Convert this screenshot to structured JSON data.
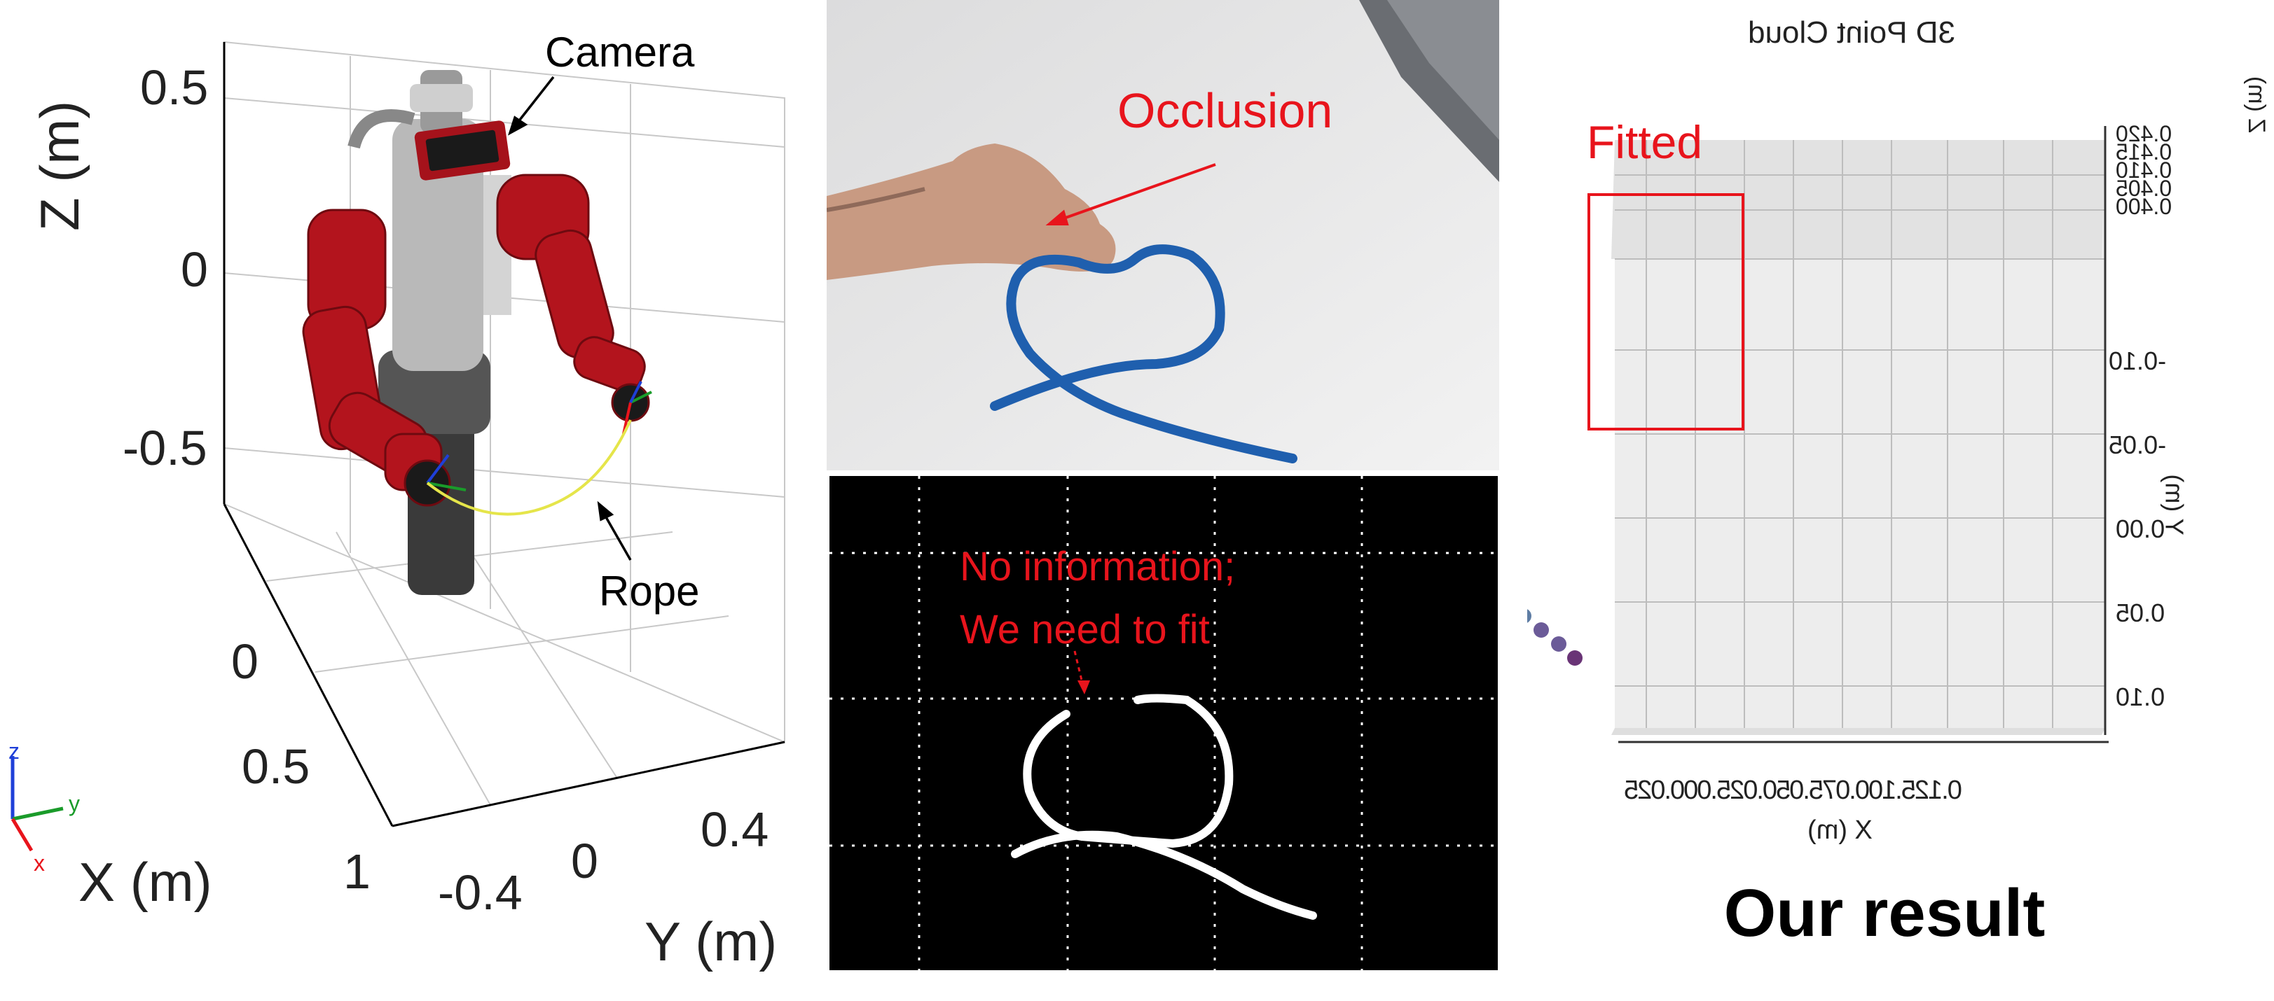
{
  "robot_panel": {
    "z_axis_label": "Z (m)",
    "x_axis_label": "X (m)",
    "y_axis_label": "Y (m)",
    "z_ticks": [
      "0.5",
      "0",
      "-0.5"
    ],
    "x_ticks": [
      "0",
      "0.5",
      "1"
    ],
    "y_ticks": [
      "-0.4",
      "0",
      "0.4"
    ],
    "camera_label": "Camera",
    "rope_label": "Rope",
    "triad": {
      "z": "z",
      "y": "y",
      "x": "x"
    }
  },
  "photo_panel": {
    "occlusion_label": "Occlusion"
  },
  "mask_panel": {
    "note_line1": "No information;",
    "note_line2": "We need to fit"
  },
  "cloud_panel": {
    "title": "3D Point Cloud",
    "fitted_label": "Fitted",
    "x_axis_label": "X (m)",
    "y_axis_label": "Y (m)",
    "z_axis_label": "Z (m)",
    "x_ticks": "0.125.100.075.050.025.000.025",
    "y_ticks": [
      "0.10",
      "0.05",
      "0.00",
      "-0.05",
      "-0.10"
    ],
    "z_ticks": [
      "0.420",
      "0.415",
      "0.410",
      "0.405",
      "0.400"
    ]
  },
  "result_title": "Our result",
  "colors": {
    "red": "#e8141c",
    "rope_blue": "#1f5fae",
    "robot_red": "#b3141d"
  }
}
